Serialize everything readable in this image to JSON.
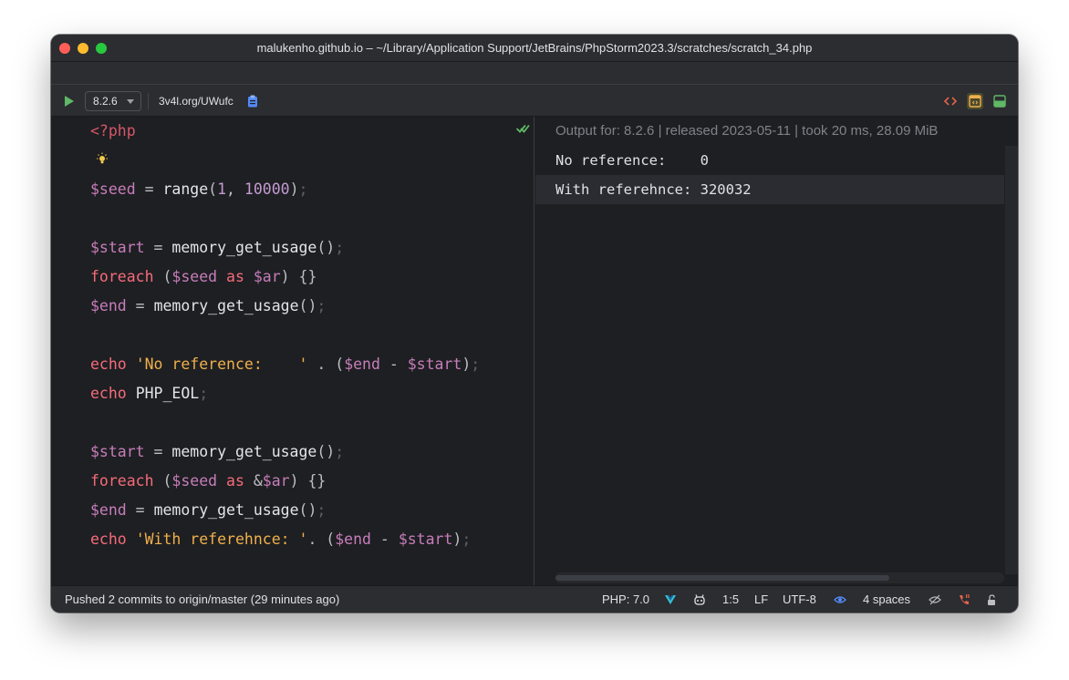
{
  "window": {
    "title": "malukenho.github.io – ~/Library/Application Support/JetBrains/PhpStorm2023.3/scratches/scratch_34.php"
  },
  "toolbar": {
    "php_version": "8.2.6",
    "share_link": "3v4l.org/UWufc"
  },
  "editor": {
    "lines": {
      "l1": {
        "open_tag": "<?php"
      },
      "l3": {
        "var": "$seed",
        "eq": " = ",
        "fn": "range",
        "p1": "(",
        "n1": "1",
        "comma": ", ",
        "n2": "10000",
        "p2": ")",
        "semi": ";"
      },
      "l5": {
        "var": "$start",
        "eq": " = ",
        "fn": "memory_get_usage",
        "parens": "()",
        "semi": ";"
      },
      "l6": {
        "kw": "foreach",
        "p1": " (",
        "v1": "$seed",
        "as": " as ",
        "v2": "$ar",
        "rest": ") {}"
      },
      "l7": {
        "var": "$end",
        "eq": " = ",
        "fn": "memory_get_usage",
        "parens": "()",
        "semi": ";"
      },
      "l9": {
        "kw": "echo",
        "sp": " ",
        "str": "'No reference:    '",
        "dot": " . (",
        "v1": "$end",
        "minus": " - ",
        "v2": "$start",
        "close": ")",
        "semi": ";"
      },
      "l10": {
        "kw": "echo",
        "sp": " ",
        "const": "PHP_EOL",
        "semi": ";"
      },
      "l12": {
        "var": "$start",
        "eq": " = ",
        "fn": "memory_get_usage",
        "parens": "()",
        "semi": ";"
      },
      "l13": {
        "kw": "foreach",
        "p1": " (",
        "v1": "$seed",
        "as": " as ",
        "amp": "&",
        "v2": "$ar",
        "rest": ") {}"
      },
      "l14": {
        "var": "$end",
        "eq": " = ",
        "fn": "memory_get_usage",
        "parens": "()",
        "semi": ";"
      },
      "l15": {
        "kw": "echo",
        "sp": " ",
        "str": "'With referehnce: '",
        "dot": ". (",
        "v1": "$end",
        "minus": " - ",
        "v2": "$start",
        "close": ")",
        "semi": ";"
      }
    }
  },
  "output": {
    "header": "Output for: 8.2.6 | released 2023-05-11 | took 20 ms, 28.09 MiB",
    "lines": [
      "No reference:    0",
      "With referehnce: 320032"
    ]
  },
  "statusbar": {
    "message": "Pushed 2 commits to origin/master (29 minutes ago)",
    "php_level": "PHP: 7.0",
    "position": "1:5",
    "line_separator": "LF",
    "encoding": "UTF-8",
    "indent": "4 spaces"
  },
  "colors": {
    "background": "#1e1f22",
    "keyword": "#f56b7b",
    "variable": "#c77dbb",
    "string": "#f0b04b",
    "run_green": "#5fb865"
  }
}
